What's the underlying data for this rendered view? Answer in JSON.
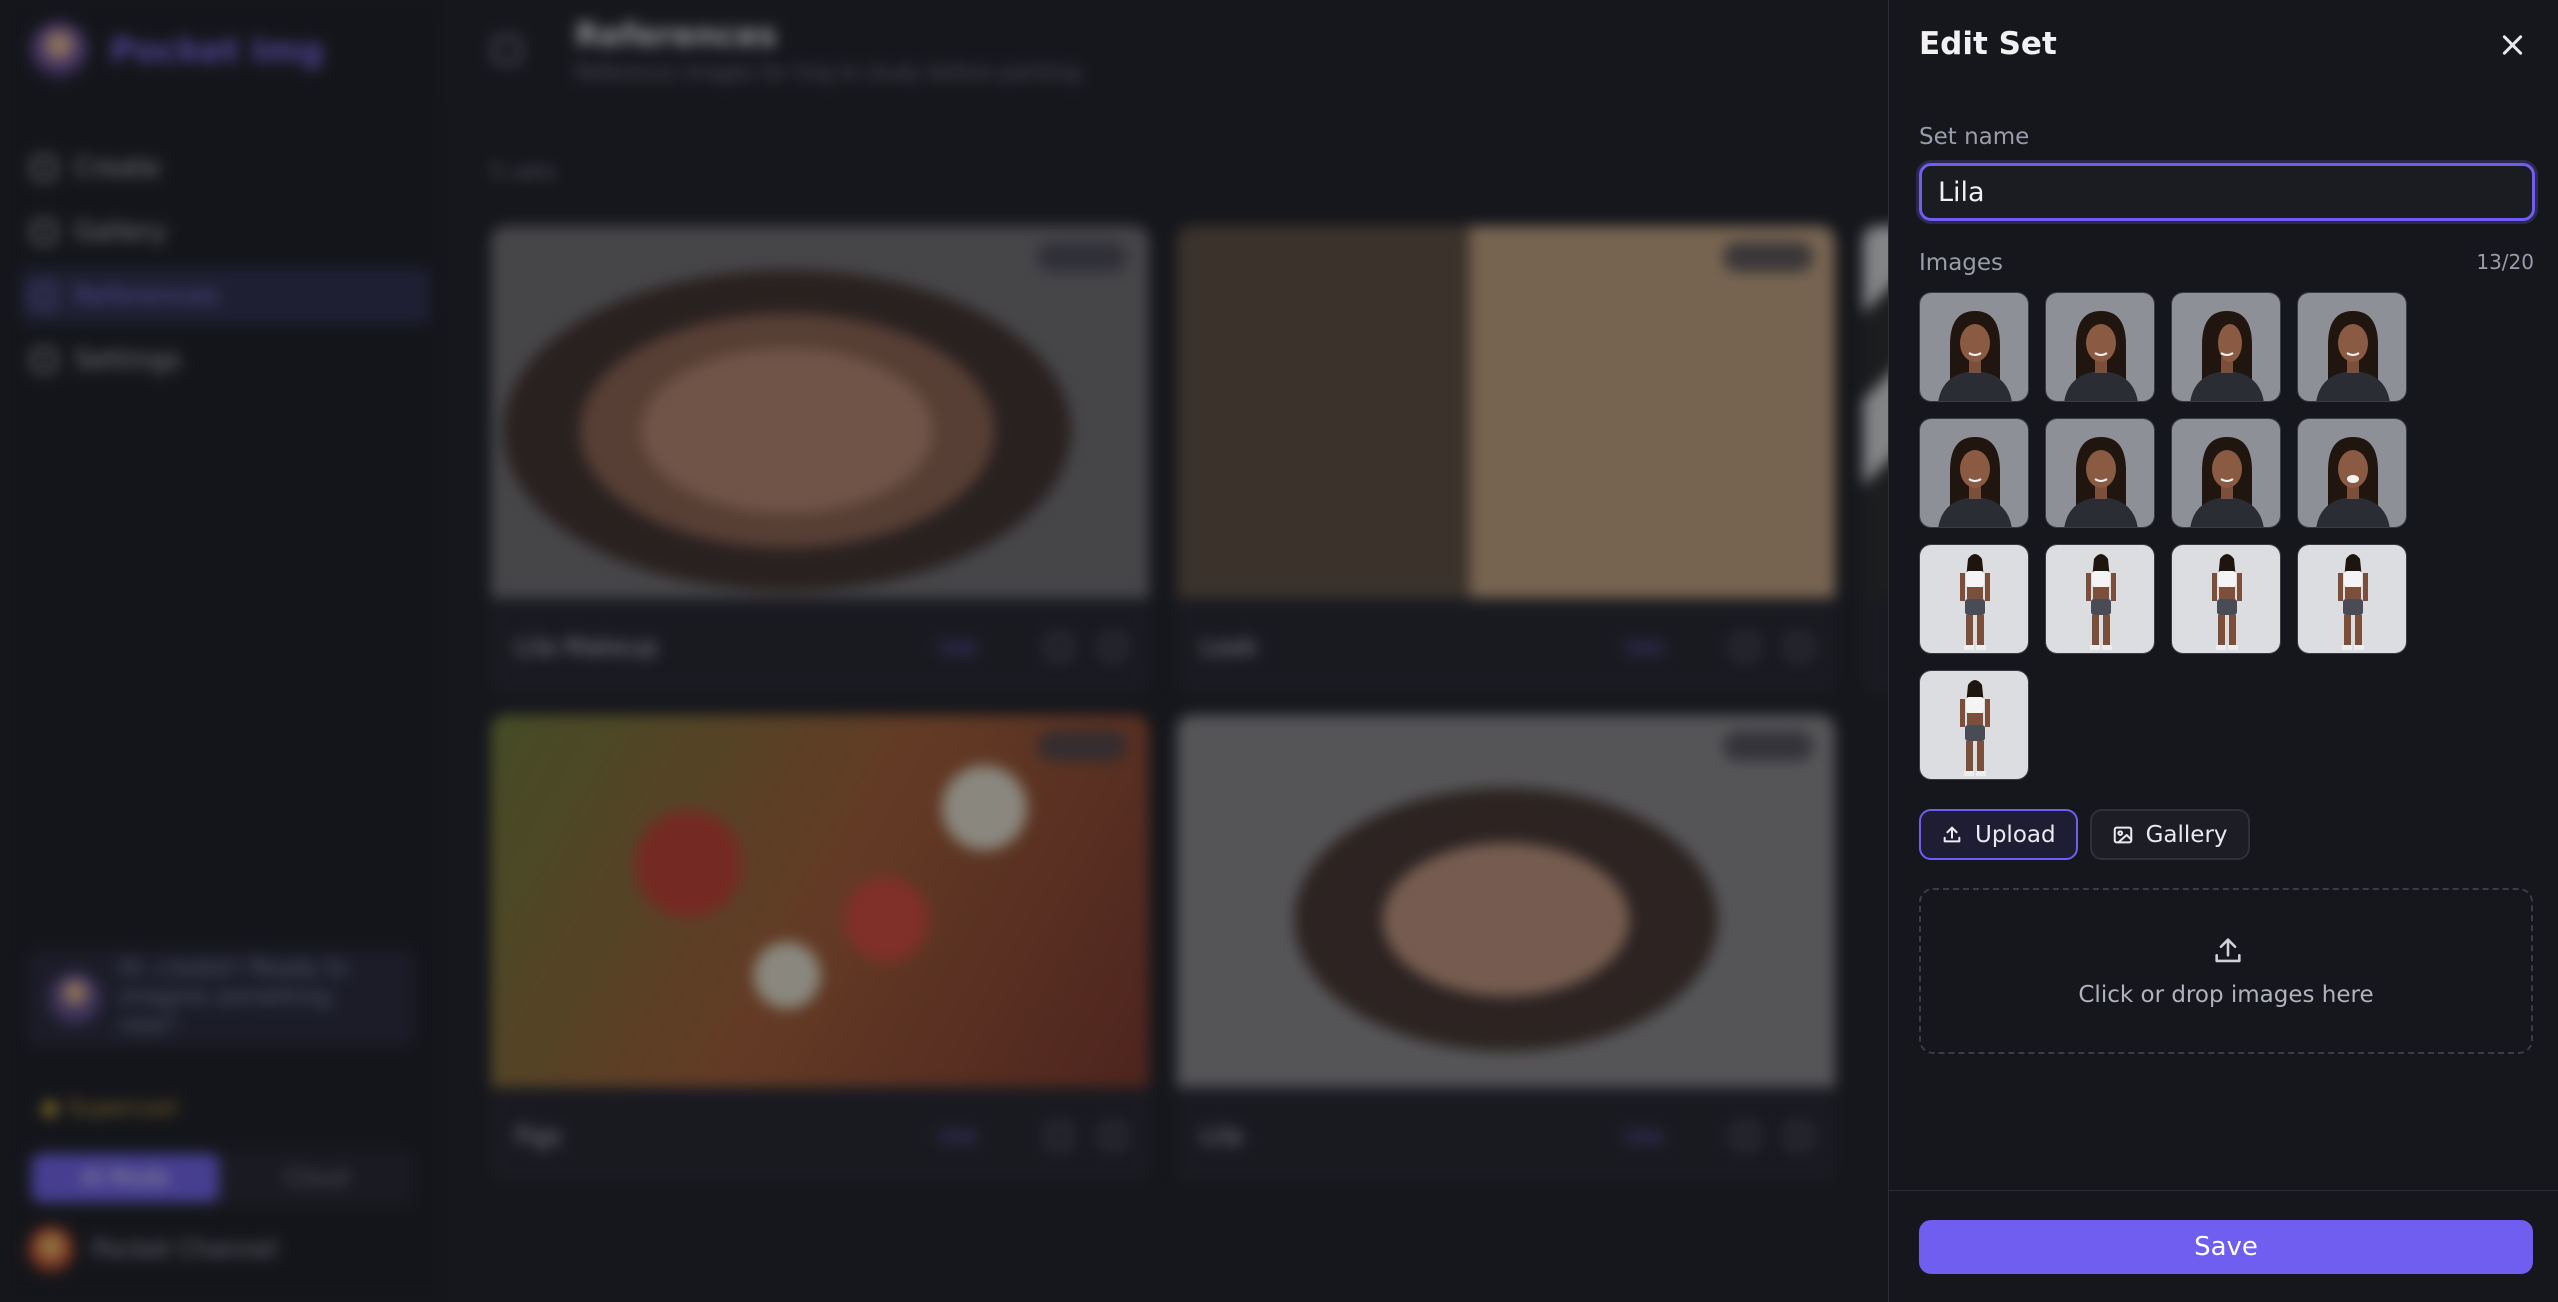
{
  "app": {
    "brand": "Pocket Img",
    "nav": [
      "Create",
      "Gallery",
      "References",
      "Settings"
    ],
    "promo_text": "Hi, creator! Ready to imagine something new?",
    "plan": "Supercool",
    "modes": [
      "AI Mode",
      "Cloud"
    ],
    "user_name": "Pocket Channel",
    "page_title": "References",
    "page_subtitle": "Reference images for Img to study before painting",
    "set_count": "5 sets",
    "cards": [
      {
        "name": "Lila Makeup",
        "use": "Use"
      },
      {
        "name": "Look",
        "use": "Use"
      },
      {
        "name": "Figs",
        "use": "Use"
      },
      {
        "name": "Lila",
        "use": "Use"
      }
    ]
  },
  "panel": {
    "title": "Edit Set",
    "name_label": "Set name",
    "name_value": "Lila",
    "images_label": "Images",
    "images_count": "13/20",
    "thumbnails": [
      "portrait",
      "portrait",
      "portrait-profile",
      "portrait",
      "portrait",
      "portrait",
      "portrait",
      "portrait-laugh",
      "full-body",
      "full-body",
      "full-body-side",
      "full-body-back",
      "full-body"
    ],
    "upload_label": "Upload",
    "gallery_label": "Gallery",
    "dropzone_text": "Click or drop images here",
    "save_label": "Save"
  },
  "colors": {
    "accent": "#6f5ef0",
    "background": "#16171c",
    "panel": "#16171c",
    "muted_text": "#9a9cab"
  },
  "icons": [
    "close-icon",
    "upload-icon",
    "gallery-icon",
    "dropzone-upload-icon"
  ]
}
